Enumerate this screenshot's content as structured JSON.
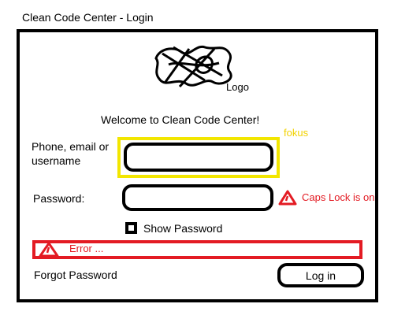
{
  "window": {
    "title": "Clean Code Center - Login"
  },
  "logo": {
    "label": "Logo",
    "icon": "logo-scribble"
  },
  "welcome": {
    "text": "Welcome to Clean Code Center!"
  },
  "focus_annotation": {
    "text": "fokus",
    "color": "#f2e600"
  },
  "form": {
    "username_label": "Phone, email or username",
    "username_value": "",
    "password_label": "Password:",
    "password_value": "",
    "caps_lock_warning": "Caps Lock is on",
    "show_password_label": "Show Password",
    "show_password_checked": false,
    "error_text": "Error ...",
    "forgot_password_label": "Forgot Password",
    "login_button_label": "Log in"
  },
  "colors": {
    "warning": "#e31b23",
    "focus": "#f2e600"
  },
  "icons": {
    "caps_lock": "warning-triangle-icon",
    "error": "error-triangle-icon"
  }
}
